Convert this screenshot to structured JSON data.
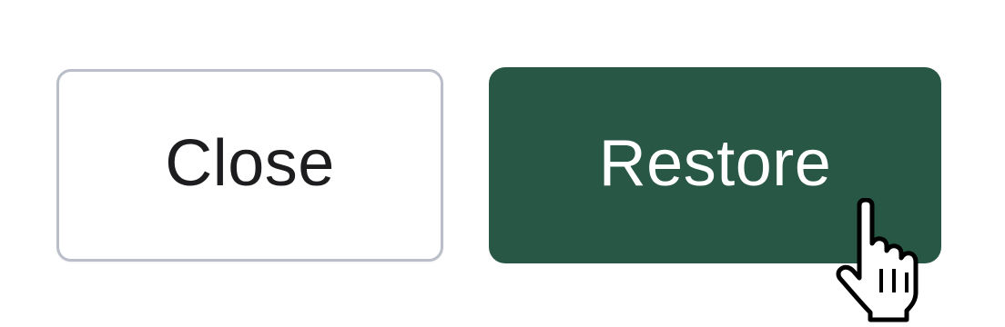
{
  "dialog_actions": {
    "close_label": "Close",
    "restore_label": "Restore",
    "restore_color": "#285746",
    "close_border_color": "#b9bec8"
  },
  "cursor": {
    "icon": "hand-pointer-icon"
  }
}
